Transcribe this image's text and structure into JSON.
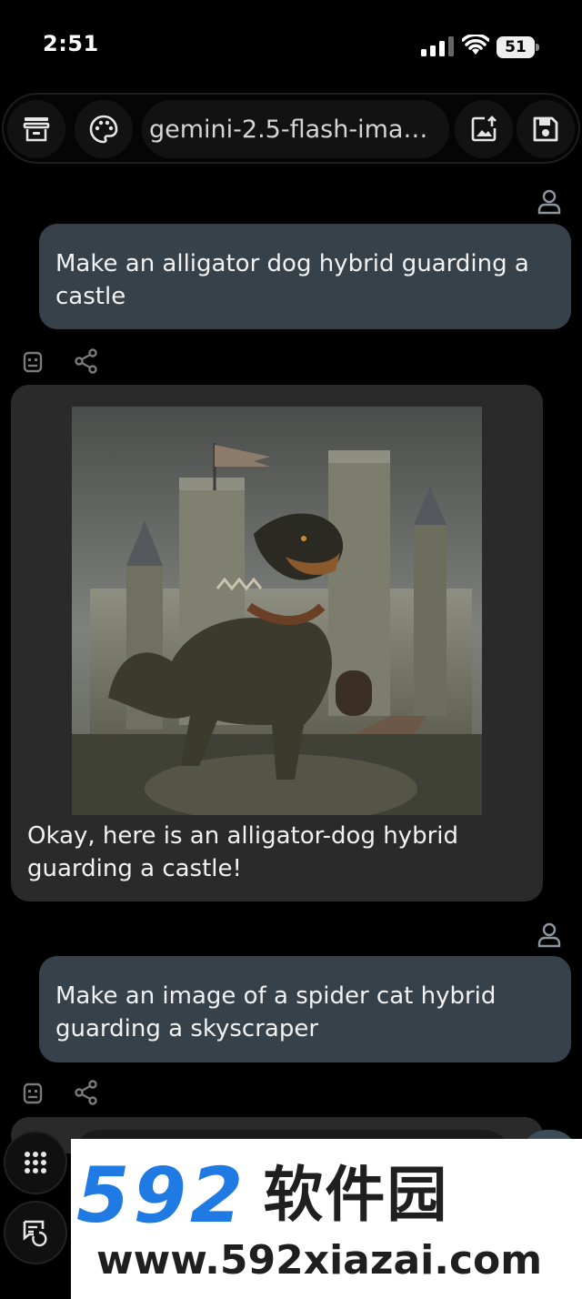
{
  "status_bar": {
    "time": "2:51",
    "battery": "51"
  },
  "toolbar": {
    "model_name": "gemini-2.5-flash-image-preview",
    "buttons": [
      "delete-icon",
      "palette-icon",
      "image-upload-icon",
      "save-icon"
    ]
  },
  "messages": [
    {
      "role": "user",
      "text": "Make an alligator dog hybrid guarding a castle"
    },
    {
      "role": "assistant",
      "image_alt": "Alligator-dog hybrid guarding a castle",
      "text": "Okay, here is an alligator-dog hybrid guarding a castle!"
    },
    {
      "role": "user",
      "text": "Make an image of a spider cat hybrid guarding a skyscraper"
    }
  ],
  "composer": {
    "apps_icon": "grid-icon",
    "history_icon": "chat-history-icon"
  },
  "watermark": {
    "brand_number": "592",
    "brand_cn": "软件园",
    "url": "www.592xiazai.com"
  },
  "colors": {
    "background": "#000000",
    "user_bubble": "#36414a",
    "bot_bubble": "#2a2a2a",
    "watermark_blue": "#1f7be3"
  }
}
